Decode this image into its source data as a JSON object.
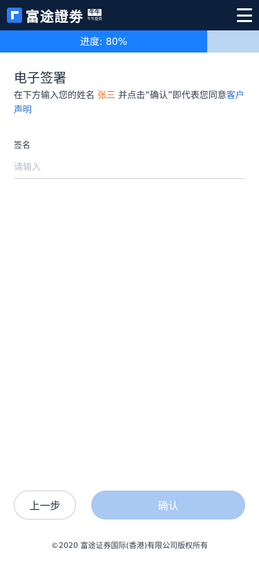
{
  "header": {
    "logo_text": "富途證劵",
    "logo_badge": "牛牛",
    "logo_badge_sub": "牛牛投资",
    "menu_icon": "hamburger-menu-icon"
  },
  "progress": {
    "label": "进度: 80%",
    "percent": 80,
    "fill_color": "#1a7fff",
    "track_color": "#bcd5f3"
  },
  "content": {
    "title": "电子签署",
    "desc_prefix": "在下方输入您的姓名 ",
    "desc_name": "张三",
    "desc_middle": " 并点击“确认”即代表您同意",
    "desc_link": "客户声明"
  },
  "form": {
    "label": "签名",
    "placeholder": "请输入",
    "value": ""
  },
  "buttons": {
    "prev": "上一步",
    "confirm": "确认"
  },
  "footer": {
    "copyright": "©2020 富途证券国际(香港)有限公司版权所有"
  },
  "colors": {
    "header_bg": "#0c1f3b",
    "accent": "#1a7fff",
    "name_highlight": "#f06a22",
    "link": "#2a6fd6",
    "confirm_disabled": "#a9c8f2"
  }
}
